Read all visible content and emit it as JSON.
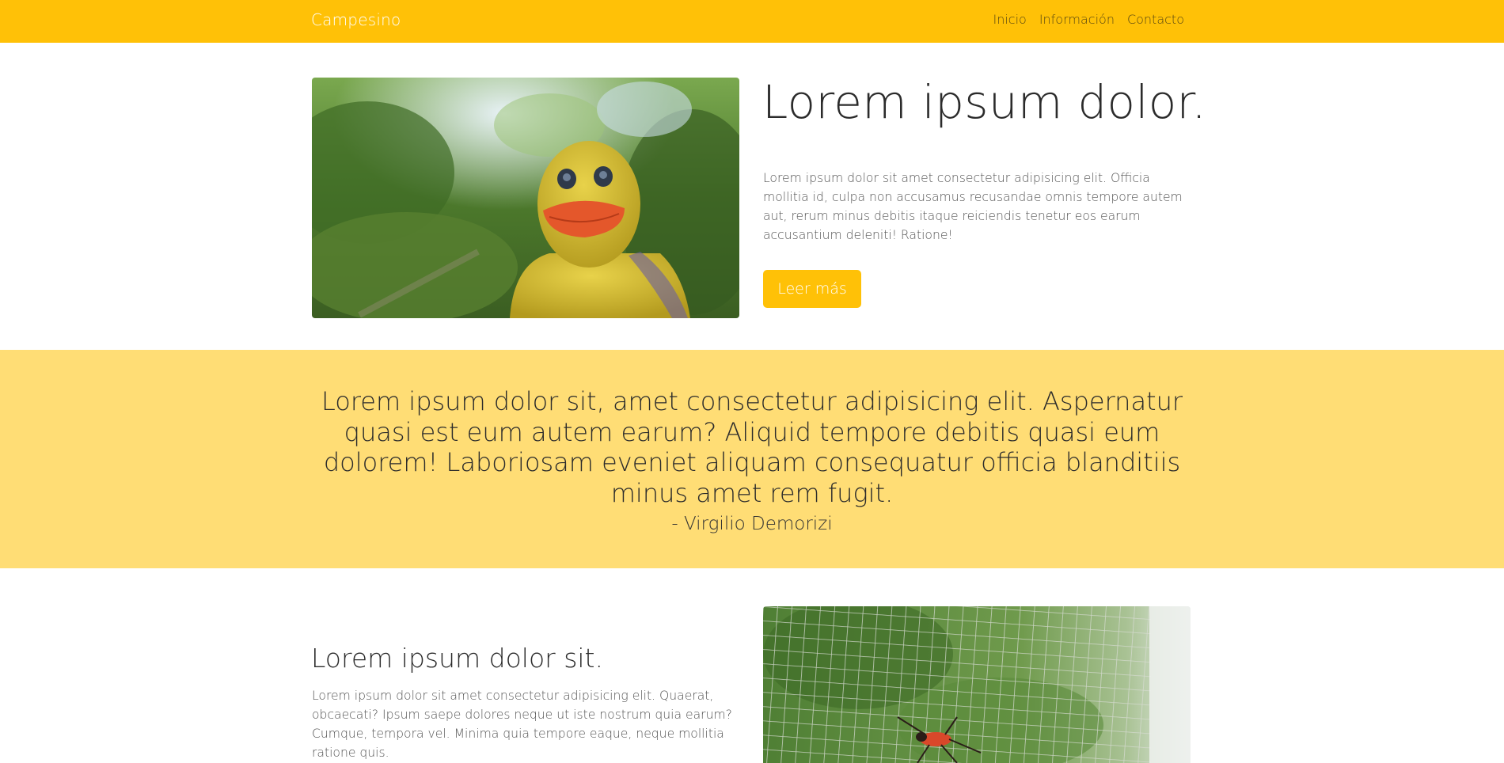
{
  "navbar": {
    "brand": "Campesino",
    "links": [
      "Inicio",
      "Información",
      "Contacto"
    ],
    "background": "#ffc107"
  },
  "hero": {
    "title": "Lorem ipsum dolor.",
    "text": "Lorem ipsum dolor sit amet consectetur adipisicing elit. Officia mollitia id, culpa non accusamus recusandae omnis tempore autem aut, rerum minus debitis itaque reiciendis tenetur eos earum accusantium deleniti! Ratione!",
    "button_label": "Leer más",
    "image": "rubber-duck-photo"
  },
  "quote": {
    "text": "Lorem ipsum dolor sit, amet consectetur adipisicing elit. Aspernatur quasi est eum autem earum? Aliquid tempore debitis quasi eum dolorem! Laboriosam eveniet aliquam consequatur officia blanditiis minus amet rem fugit.",
    "author": "- Virgilio Demorizi",
    "background": "#ffdd75"
  },
  "section": {
    "title": "Lorem ipsum dolor sit.",
    "text": "Lorem ipsum dolor sit amet consectetur adipisicing elit. Quaerat, obcaecati? Ipsum saepe dolores neque ut iste nostrum quia earum? Cumque, tempora vel. Minima quia tempore eaque, neque mollitia ratione quis.",
    "image": "insect-on-wire-mesh-photo"
  }
}
